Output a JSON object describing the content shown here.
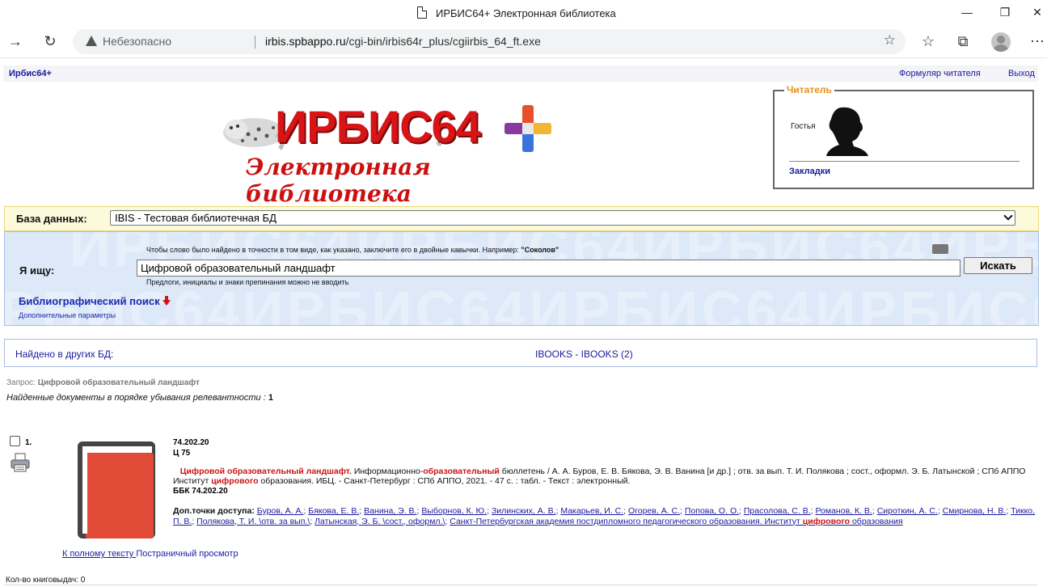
{
  "browser": {
    "tab_title": "ИРБИС64+ Электронная библиотека",
    "security_label": "Небезопасно",
    "url_host": "irbis.spbappo.ru",
    "url_path": "/cgi-bin/irbis64r_plus/cgiirbis_64_ft.exe"
  },
  "topbar": {
    "brand": "Ирбис64+",
    "reader_form": "Формуляр читателя",
    "logout": "Выход"
  },
  "logo": {
    "word": "ИРБИС64",
    "reg": "®",
    "tagline": "Электронная библиотека"
  },
  "reader": {
    "legend": "Читатель",
    "name": "Гостья",
    "bookmarks": "Закладки"
  },
  "database": {
    "label": "База данных:",
    "selected": "IBIS - Тестовая библиотечная БД"
  },
  "search": {
    "hint_exact": "Чтобы слово было найдено в точности в том виде, как указано, заключите его в двойные кавычки. Например: ",
    "hint_example": "\"Соколов\"",
    "label": "Я ищу:",
    "query_value": "Цифровой образовательный ландшафт",
    "button": "Искать",
    "hint_prepositions": "Предлоги, инициалы и знаки препинания можно не вводить",
    "bibliographic": "Библиографический поиск",
    "extra_params": "Дополнительные параметры",
    "watermark": "ИРБИС64ИРБИС64ИРБИС64ИРБИС64"
  },
  "other_db": {
    "label": "Найдено в других БД:",
    "link": "IBOOKS - IBOOKS (2)"
  },
  "results": {
    "query_label": "Запрос: ",
    "query_text": "Цифровой образовательный ландшафт",
    "found_label": "Найденные документы в порядке убывания релевантности : ",
    "found_count": "1",
    "copies_label": "Кол-во книговыдач: 0"
  },
  "record": {
    "number": "1.",
    "code1": "74.202.20",
    "code2": "Ц 75",
    "title_hl": "Цифровой образовательный ландшафт.",
    "desc_1": " Информационно-",
    "desc_hl_1": "образовательный",
    "desc_2": " бюллетень / А. А. Буров, Е. В. Бякова, Э. В. Ванина [и др.] ; отв. за вып. Т. И. Полякова ; сост., оформл. Э. Б. Латынской ; СПб АППО Институт ",
    "desc_hl_2": "цифрового",
    "desc_3": " образования. ИБЦ. - Санкт-Петербург : СПб АППО, 2021. - 47 с. : табл. - Текст : электронный.",
    "bbk": "ББК 74.202.20",
    "access_label": "Доп.точки доступа:",
    "access_links": [
      "Буров, А. А.",
      "Бякова, Е. В.",
      "Ванина, Э. В.",
      "Выборнов, К. Ю.",
      "Зилинских, А. В.",
      "Макарьев, И. С.",
      "Огорев, А. С.",
      "Попова, О. О.",
      "Прасолова, С. В.",
      "Романов, К. В.",
      "Сироткин, А. С.",
      "Смирнова, Н. В.",
      "Тикко, П. В.",
      "Полякова, Т. И. \\отв. за вып.\\",
      "Латынская, Э. Б. \\сост., оформл.\\"
    ],
    "access_org_1": "Санкт-Петербургская академия постдипломного педагогического образования. Институт ",
    "access_org_hl": "цифрового",
    "access_org_2": " образования",
    "full_text": "К полному тексту ",
    "page_view": "Постраничный просмотр"
  },
  "colors": {
    "link": "#1a1a9c",
    "highlight": "#cc1414",
    "logo_red": "#d81416",
    "reader_legend": "#e7901a",
    "search_bg": "#dde9f8",
    "db_bg": "#fdf9db"
  }
}
